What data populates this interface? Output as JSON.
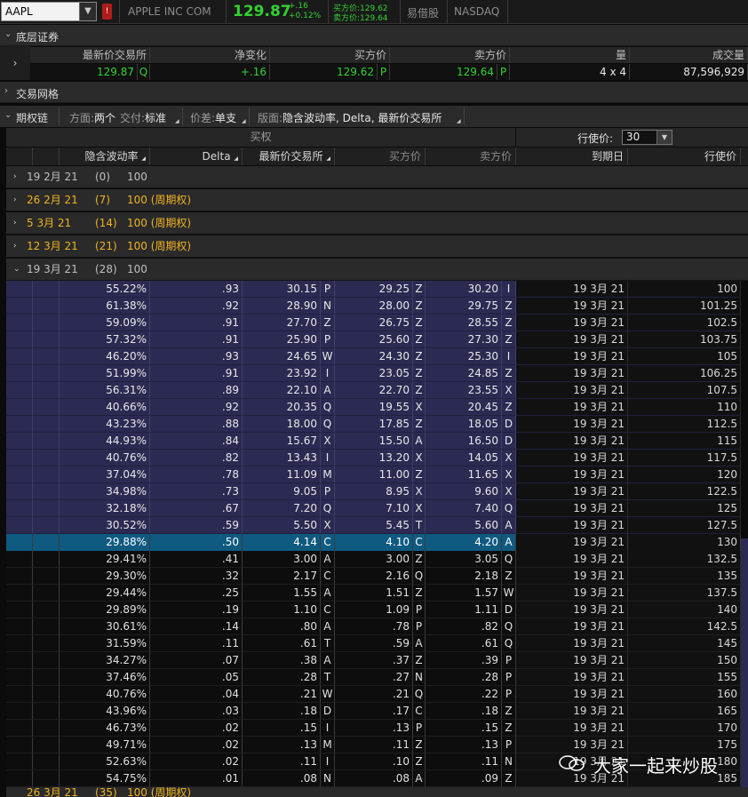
{
  "header": {
    "symbol": "AAPL",
    "company": "APPLE INC COM",
    "last": "129.87",
    "change": "+.16",
    "change_pct": "+0.12%",
    "bid_text": "买方价:129.62",
    "ask_text": "卖方价:129.64",
    "htb": "易借股",
    "exchange": "NASDAQ"
  },
  "sections": {
    "underlying": "底层证券",
    "trade_grid": "交易网格",
    "option_chain": "期权链"
  },
  "underlying": {
    "headers": [
      "最新价交易所",
      "净变化",
      "买方价",
      "卖方价",
      "量",
      "成交量"
    ],
    "last": "129.87",
    "last_ex": "Q",
    "net_change": "+.16",
    "bid": "129.62",
    "bid_ex": "P",
    "ask": "129.64",
    "ask_ex": "P",
    "size": "4 x 4",
    "volume": "87,596,929"
  },
  "chain_bar": {
    "side_label": "方面:",
    "side_value": "两个",
    "expiry_label": "交付:",
    "expiry_value": "标准",
    "spread_label": "价差:",
    "spread_value": "单支",
    "layout_label": "版面:",
    "layout_value": "隐含波动率, Delta, 最新价交易所"
  },
  "chain_header": {
    "calls": "买权",
    "strikes_label": "行使价:",
    "strikes_value": "30",
    "cols": [
      "隐含波动率",
      "Delta",
      "最新价交易所",
      "买方价",
      "卖方价",
      "到期日",
      "行使价"
    ]
  },
  "expirations": [
    {
      "date": "19 2月 21",
      "count": "(0)",
      "type": "100",
      "weekly": false
    },
    {
      "date": "26 2月 21",
      "count": "(7)",
      "type": "100 (周期权)",
      "weekly": true
    },
    {
      "date": "5 3月 21",
      "count": "(14)",
      "type": "100 (周期权)",
      "weekly": true
    },
    {
      "date": "12 3月 21",
      "count": "(21)",
      "type": "100 (周期权)",
      "weekly": true
    },
    {
      "date": "19 3月 21",
      "count": "(28)",
      "type": "100",
      "weekly": false
    }
  ],
  "bottom_expiration": {
    "date": "26 3月 21",
    "count": "(35)",
    "type": "100 (周期权)"
  },
  "options": [
    {
      "iv": "55.22%",
      "delta": ".93",
      "last": "30.15",
      "lx": "P",
      "bid": "29.25",
      "bx": "Z",
      "ask": "30.20",
      "ax": "I",
      "exp": "19 3月 21",
      "strike": "100",
      "state": "itm"
    },
    {
      "iv": "61.38%",
      "delta": ".92",
      "last": "28.90",
      "lx": "N",
      "bid": "28.00",
      "bx": "Z",
      "ask": "29.75",
      "ax": "Z",
      "exp": "19 3月 21",
      "strike": "101.25",
      "state": "itm"
    },
    {
      "iv": "59.09%",
      "delta": ".91",
      "last": "27.70",
      "lx": "Z",
      "bid": "26.75",
      "bx": "Z",
      "ask": "28.55",
      "ax": "Z",
      "exp": "19 3月 21",
      "strike": "102.5",
      "state": "itm"
    },
    {
      "iv": "57.32%",
      "delta": ".91",
      "last": "25.90",
      "lx": "P",
      "bid": "25.60",
      "bx": "Z",
      "ask": "27.30",
      "ax": "Z",
      "exp": "19 3月 21",
      "strike": "103.75",
      "state": "itm"
    },
    {
      "iv": "46.20%",
      "delta": ".93",
      "last": "24.65",
      "lx": "W",
      "bid": "24.30",
      "bx": "Z",
      "ask": "25.30",
      "ax": "I",
      "exp": "19 3月 21",
      "strike": "105",
      "state": "itm"
    },
    {
      "iv": "51.99%",
      "delta": ".91",
      "last": "23.92",
      "lx": "I",
      "bid": "23.05",
      "bx": "Z",
      "ask": "24.85",
      "ax": "Z",
      "exp": "19 3月 21",
      "strike": "106.25",
      "state": "itm"
    },
    {
      "iv": "56.31%",
      "delta": ".89",
      "last": "22.10",
      "lx": "A",
      "bid": "22.70",
      "bx": "Z",
      "ask": "23.55",
      "ax": "X",
      "exp": "19 3月 21",
      "strike": "107.5",
      "state": "itm"
    },
    {
      "iv": "40.66%",
      "delta": ".92",
      "last": "20.35",
      "lx": "Q",
      "bid": "19.55",
      "bx": "X",
      "ask": "20.45",
      "ax": "Z",
      "exp": "19 3月 21",
      "strike": "110",
      "state": "itm"
    },
    {
      "iv": "43.23%",
      "delta": ".88",
      "last": "18.00",
      "lx": "Q",
      "bid": "17.85",
      "bx": "Z",
      "ask": "18.05",
      "ax": "D",
      "exp": "19 3月 21",
      "strike": "112.5",
      "state": "itm"
    },
    {
      "iv": "44.93%",
      "delta": ".84",
      "last": "15.67",
      "lx": "X",
      "bid": "15.50",
      "bx": "A",
      "ask": "16.50",
      "ax": "D",
      "exp": "19 3月 21",
      "strike": "115",
      "state": "itm"
    },
    {
      "iv": "40.76%",
      "delta": ".82",
      "last": "13.43",
      "lx": "I",
      "bid": "13.20",
      "bx": "X",
      "ask": "14.05",
      "ax": "X",
      "exp": "19 3月 21",
      "strike": "117.5",
      "state": "itm"
    },
    {
      "iv": "37.04%",
      "delta": ".78",
      "last": "11.09",
      "lx": "M",
      "bid": "11.00",
      "bx": "Z",
      "ask": "11.65",
      "ax": "X",
      "exp": "19 3月 21",
      "strike": "120",
      "state": "itm"
    },
    {
      "iv": "34.98%",
      "delta": ".73",
      "last": "9.05",
      "lx": "P",
      "bid": "8.95",
      "bx": "X",
      "ask": "9.60",
      "ax": "X",
      "exp": "19 3月 21",
      "strike": "122.5",
      "state": "itm"
    },
    {
      "iv": "32.18%",
      "delta": ".67",
      "last": "7.20",
      "lx": "Q",
      "bid": "7.10",
      "bx": "X",
      "ask": "7.40",
      "ax": "Q",
      "exp": "19 3月 21",
      "strike": "125",
      "state": "itm"
    },
    {
      "iv": "30.52%",
      "delta": ".59",
      "last": "5.50",
      "lx": "X",
      "bid": "5.45",
      "bx": "T",
      "ask": "5.60",
      "ax": "A",
      "exp": "19 3月 21",
      "strike": "127.5",
      "state": "itm"
    },
    {
      "iv": "29.88%",
      "delta": ".50",
      "last": "4.14",
      "lx": "C",
      "bid": "4.10",
      "bx": "C",
      "ask": "4.20",
      "ax": "A",
      "exp": "19 3月 21",
      "strike": "130",
      "state": "atm"
    },
    {
      "iv": "29.41%",
      "delta": ".41",
      "last": "3.00",
      "lx": "A",
      "bid": "3.00",
      "bx": "Z",
      "ask": "3.05",
      "ax": "Q",
      "exp": "19 3月 21",
      "strike": "132.5",
      "state": "otm"
    },
    {
      "iv": "29.30%",
      "delta": ".32",
      "last": "2.17",
      "lx": "C",
      "bid": "2.16",
      "bx": "Q",
      "ask": "2.18",
      "ax": "Z",
      "exp": "19 3月 21",
      "strike": "135",
      "state": "otm"
    },
    {
      "iv": "29.44%",
      "delta": ".25",
      "last": "1.55",
      "lx": "A",
      "bid": "1.51",
      "bx": "Z",
      "ask": "1.57",
      "ax": "W",
      "exp": "19 3月 21",
      "strike": "137.5",
      "state": "otm"
    },
    {
      "iv": "29.89%",
      "delta": ".19",
      "last": "1.10",
      "lx": "C",
      "bid": "1.09",
      "bx": "P",
      "ask": "1.11",
      "ax": "D",
      "exp": "19 3月 21",
      "strike": "140",
      "state": "otm"
    },
    {
      "iv": "30.61%",
      "delta": ".14",
      "last": ".80",
      "lx": "A",
      "bid": ".78",
      "bx": "P",
      "ask": ".82",
      "ax": "Q",
      "exp": "19 3月 21",
      "strike": "142.5",
      "state": "otm"
    },
    {
      "iv": "31.59%",
      "delta": ".11",
      "last": ".61",
      "lx": "T",
      "bid": ".59",
      "bx": "A",
      "ask": ".61",
      "ax": "Q",
      "exp": "19 3月 21",
      "strike": "145",
      "state": "otm"
    },
    {
      "iv": "34.27%",
      "delta": ".07",
      "last": ".38",
      "lx": "A",
      "bid": ".37",
      "bx": "Z",
      "ask": ".39",
      "ax": "P",
      "exp": "19 3月 21",
      "strike": "150",
      "state": "otm"
    },
    {
      "iv": "37.46%",
      "delta": ".05",
      "last": ".28",
      "lx": "T",
      "bid": ".27",
      "bx": "N",
      "ask": ".28",
      "ax": "P",
      "exp": "19 3月 21",
      "strike": "155",
      "state": "otm"
    },
    {
      "iv": "40.76%",
      "delta": ".04",
      "last": ".21",
      "lx": "W",
      "bid": ".21",
      "bx": "Q",
      "ask": ".22",
      "ax": "P",
      "exp": "19 3月 21",
      "strike": "160",
      "state": "otm"
    },
    {
      "iv": "43.96%",
      "delta": ".03",
      "last": ".18",
      "lx": "D",
      "bid": ".17",
      "bx": "C",
      "ask": ".18",
      "ax": "Z",
      "exp": "19 3月 21",
      "strike": "165",
      "state": "otm"
    },
    {
      "iv": "46.73%",
      "delta": ".02",
      "last": ".15",
      "lx": "I",
      "bid": ".13",
      "bx": "P",
      "ask": ".15",
      "ax": "Z",
      "exp": "19 3月 21",
      "strike": "170",
      "state": "otm"
    },
    {
      "iv": "49.71%",
      "delta": ".02",
      "last": ".13",
      "lx": "M",
      "bid": ".11",
      "bx": "Z",
      "ask": ".13",
      "ax": "P",
      "exp": "19 3月 21",
      "strike": "175",
      "state": "otm"
    },
    {
      "iv": "52.63%",
      "delta": ".02",
      "last": ".11",
      "lx": "I",
      "bid": ".10",
      "bx": "Z",
      "ask": ".11",
      "ax": "N",
      "exp": "19 3月 21",
      "strike": "180",
      "state": "otm"
    },
    {
      "iv": "54.75%",
      "delta": ".01",
      "last": ".08",
      "lx": "N",
      "bid": ".08",
      "bx": "A",
      "ask": ".09",
      "ax": "Z",
      "exp": "19 3月 21",
      "strike": "185",
      "state": "otm"
    }
  ],
  "watermark": "大家一起来炒股",
  "colors": {
    "up": "#31d231",
    "weekly": "#f0b322",
    "itm_row": "#2a2a52",
    "atm_row": "#0f5a80"
  }
}
